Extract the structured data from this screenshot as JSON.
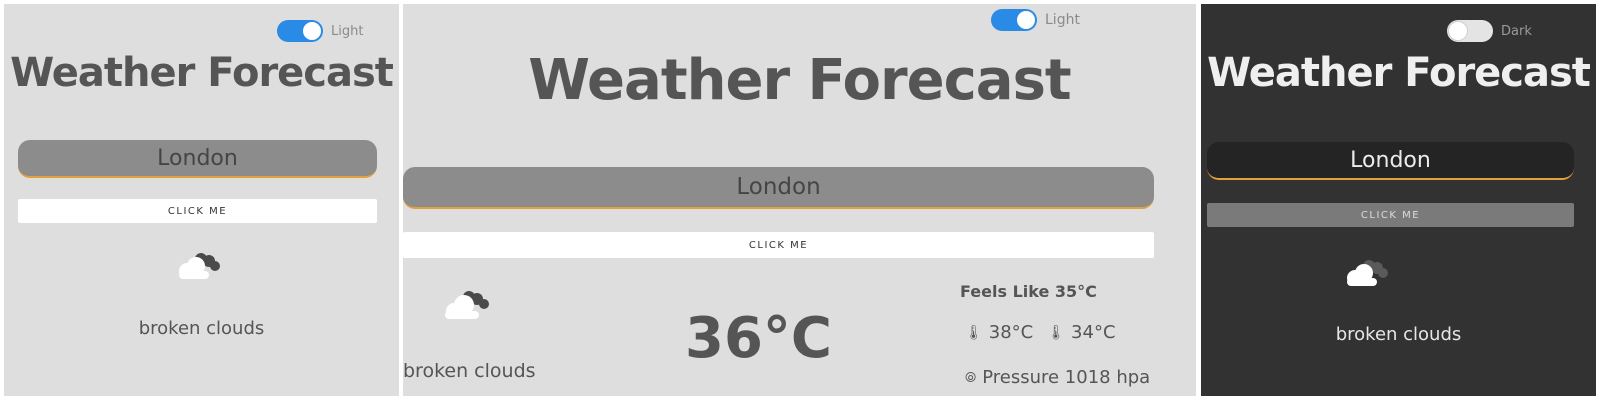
{
  "panels": [
    {
      "theme": "light",
      "toggle": {
        "label": "Light",
        "state": "on"
      },
      "title": "Weather Forecast",
      "city_input": {
        "value": "London"
      },
      "button_label": "CLICK ME",
      "weather": {
        "icon": "cloud-icon",
        "description": "broken clouds"
      }
    },
    {
      "theme": "light",
      "toggle": {
        "label": "Light",
        "state": "on"
      },
      "title": "Weather Forecast",
      "city_input": {
        "value": "London"
      },
      "button_label": "CLICK ME",
      "weather": {
        "icon": "cloud-icon",
        "description": "broken clouds",
        "temperature": "36°C",
        "feels_like": "Feels Like 35°C",
        "temp_max": "38°C",
        "temp_min": "34°C",
        "pressure": "Pressure 1018 hpa"
      }
    },
    {
      "theme": "dark",
      "toggle": {
        "label": "Dark",
        "state": "off"
      },
      "title": "Weather Forecast",
      "city_input": {
        "value": "London"
      },
      "button_label": "CLICK ME",
      "weather": {
        "icon": "cloud-icon",
        "description": "broken clouds"
      }
    }
  ],
  "colors": {
    "light_bg": "#dedede",
    "dark_bg": "#323232",
    "toggle_on": "#2a8be6",
    "input_underline": "#e2a13a"
  }
}
